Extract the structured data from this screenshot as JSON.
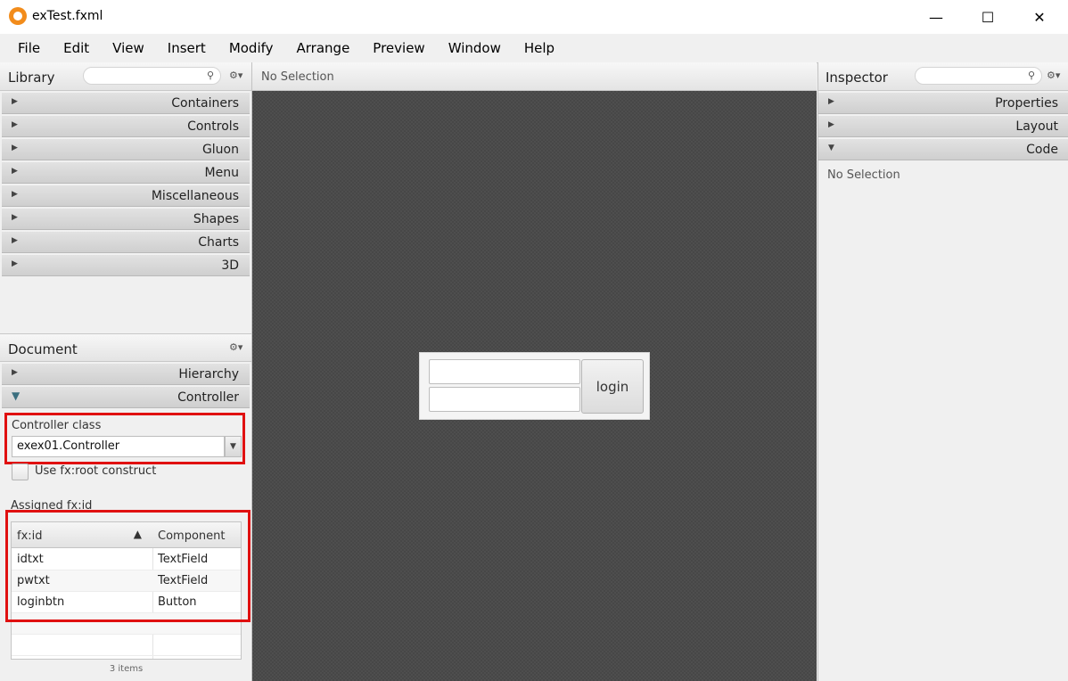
{
  "window": {
    "title": "exTest.fxml",
    "controls": {
      "minimize": "—",
      "maximize": "☐",
      "close": "✕"
    }
  },
  "menu": [
    "File",
    "Edit",
    "View",
    "Insert",
    "Modify",
    "Arrange",
    "Preview",
    "Window",
    "Help"
  ],
  "library": {
    "title": "Library",
    "categories": [
      "Containers",
      "Controls",
      "Gluon",
      "Menu",
      "Miscellaneous",
      "Shapes",
      "Charts",
      "3D"
    ]
  },
  "document": {
    "title": "Document",
    "sections": [
      "Hierarchy",
      "Controller"
    ],
    "controller_class_label": "Controller class",
    "controller_class_value": "exex01.Controller",
    "fx_root_label": "Use fx:root construct",
    "assigned_label": "Assigned fx:id",
    "table": {
      "headers": [
        "fx:id",
        "Component"
      ],
      "rows": [
        {
          "id": "idtxt",
          "component": "TextField"
        },
        {
          "id": "pwtxt",
          "component": "TextField"
        },
        {
          "id": "loginbtn",
          "component": "Button"
        }
      ],
      "count_text": "3 items"
    }
  },
  "canvas": {
    "header": "No Selection",
    "login_button": "login"
  },
  "inspector": {
    "title": "Inspector",
    "sections": [
      "Properties",
      "Layout",
      "Code"
    ],
    "empty_text": "No Selection"
  },
  "icons": {
    "search": "search-icon",
    "gear": "gear-icon",
    "collapsed": "triangle-right-icon",
    "expanded": "triangle-down-icon",
    "sort": "sort-ascending-icon"
  },
  "colors": {
    "highlight": "#e01010",
    "canvas": "#4e4e4e",
    "app_icon": "#f28c1b"
  }
}
